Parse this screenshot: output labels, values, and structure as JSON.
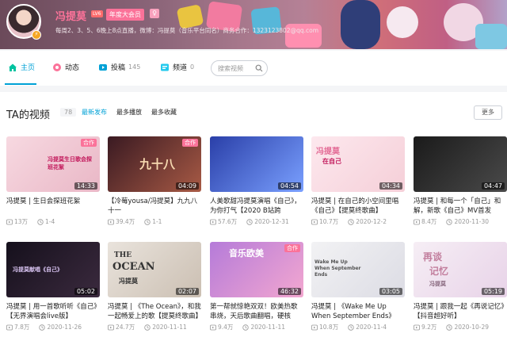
{
  "profile": {
    "username": "冯提莫",
    "level": "LV6",
    "vip_label": "年度大会员",
    "gender_icon": "♀",
    "signature": "每周2、3、5、6晚上8点直播，微博：冯提莫（音乐平台同名）商务合作：1323123802@qq.com"
  },
  "nav": {
    "items": [
      {
        "label": "主页",
        "icon": "home-icon",
        "count": ""
      },
      {
        "label": "动态",
        "icon": "dynamic-icon",
        "count": ""
      },
      {
        "label": "投稿",
        "icon": "upload-icon",
        "count": "145"
      },
      {
        "label": "频道",
        "icon": "channel-icon",
        "count": "0"
      }
    ],
    "search_placeholder": "搜索视频"
  },
  "section": {
    "title": "TA的视频",
    "count": "78",
    "sort": [
      "最新发布",
      "最多播放",
      "最多收藏"
    ],
    "more": "更多"
  },
  "videos": [
    {
      "title": "冯提莫 | 生日会探班花絮",
      "plays": "13万",
      "meta2": "1-4",
      "duration": "14:33",
      "tag": "合作",
      "thumb": [
        "#f7d9e1",
        "#e9b7c6"
      ]
    },
    {
      "title": "【冷莓yousa/冯提莫】九九八十一",
      "plays": "39.4万",
      "meta2": "1-1",
      "duration": "04:09",
      "tag": "合作",
      "thumb": [
        "#3a1a22",
        "#a85a45"
      ]
    },
    {
      "title": "人美歌甜冯提莫演唱《自己》，为你打气【2020 B站跨",
      "plays": "57.6万",
      "meta2": "2020-12-31",
      "duration": "04:54",
      "tag": "",
      "thumb": [
        "#2a3fa8",
        "#7aa0ff"
      ]
    },
    {
      "title": "冯提莫 | 在自己的小空间里唱《自己》【提莫终歌曲】",
      "plays": "10.7万",
      "meta2": "2020-12-2",
      "duration": "04:34",
      "tag": "",
      "thumb": [
        "#fde8ee",
        "#f5cfd8"
      ]
    },
    {
      "title": "冯提莫 | 和每一个「自己」和解，新歌《自己》MV首发",
      "plays": "8.4万",
      "meta2": "2020-11-30",
      "duration": "04:47",
      "tag": "",
      "thumb": [
        "#1a1a1a",
        "#4a4a4a"
      ]
    },
    {
      "title": "冯提莫 | 用一首歌听听《自己》【无界演唱会live版】",
      "plays": "7.8万",
      "meta2": "2020-11-26",
      "duration": "05:02",
      "tag": "",
      "thumb": [
        "#15101c",
        "#3b2a3e"
      ]
    },
    {
      "title": "冯提莫 | 《The Ocean》，和我一起畅爱上的歌【提莫终歌曲】",
      "plays": "24.7万",
      "meta2": "2020-11-11",
      "duration": "02:07",
      "tag": "",
      "thumb": [
        "#e9e3dc",
        "#cbbfb2"
      ]
    },
    {
      "title": "第一帮就惊艳双双！欧美热歌串烧，天后歌曲翻唱，硬核",
      "plays": "9.4万",
      "meta2": "2020-11-11",
      "duration": "46:32",
      "tag": "合作",
      "thumb": [
        "#b57bd9",
        "#f3a7d0"
      ]
    },
    {
      "title": "冯提莫 | 《Wake Me Up When September Ends》",
      "plays": "10.8万",
      "meta2": "2020-11-4",
      "duration": "03:05",
      "tag": "",
      "thumb": [
        "#f2f2f4",
        "#dcdce4"
      ]
    },
    {
      "title": "冯提莫 | 跟我一起《再说记忆》【抖音超好听】",
      "plays": "9.2万",
      "meta2": "2020-10-29",
      "duration": "05:19",
      "tag": "",
      "thumb": [
        "#f6eef5",
        "#e8d3e8"
      ]
    }
  ],
  "overlays": {
    "v0": "冯提莫生日歌会探班花絮",
    "v1": "九十八",
    "v3": "冯提莫",
    "v3b": "在自己",
    "v5": "冯提莫献唱《自己》",
    "v6a": "THE",
    "v6b": "OCEAN",
    "v6c": "冯提莫",
    "v7": "音乐欧美",
    "v8": "Wake Me Up When September Ends",
    "v9a": "再谈",
    "v9b": "记忆",
    "v9c": "冯提莫"
  },
  "colors": {
    "accent": "#00a1d6",
    "pink": "#fb7299"
  }
}
